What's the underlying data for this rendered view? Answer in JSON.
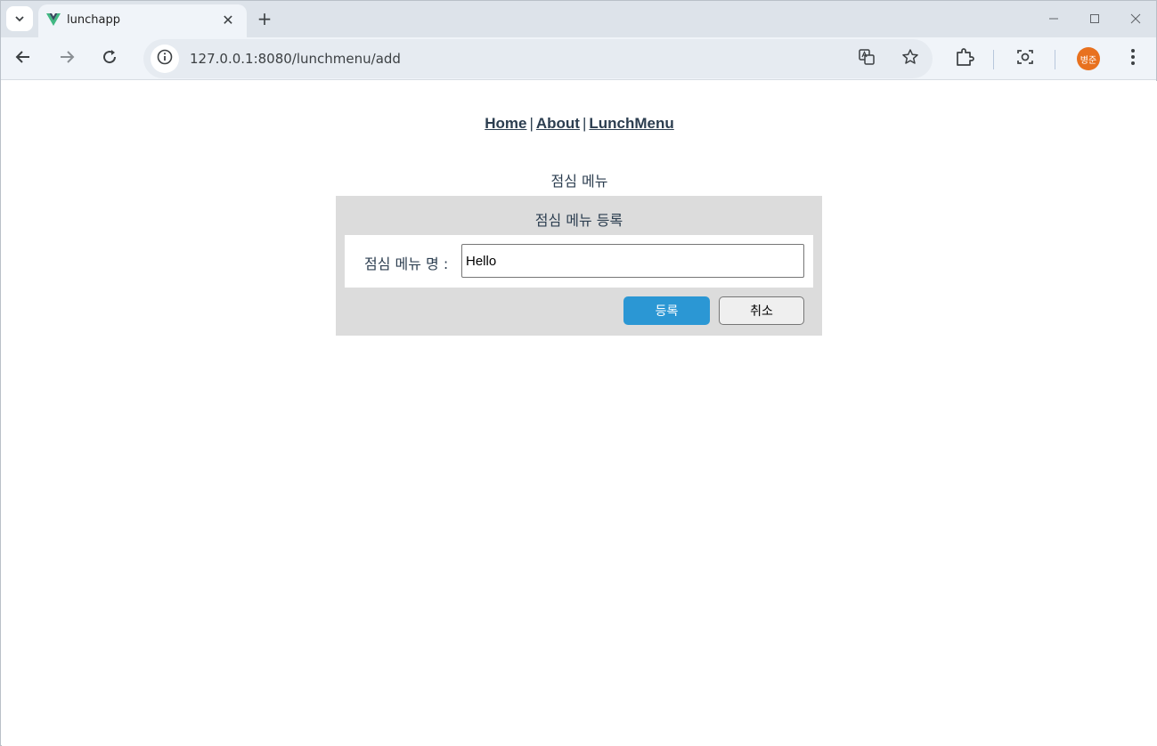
{
  "browser": {
    "tab_title": "lunchapp",
    "tab_close": "✕",
    "new_tab": "+",
    "url": "127.0.0.1:8080/lunchmenu/add",
    "profile_initials": "병준",
    "accent_color": "#e8711f"
  },
  "nav": {
    "items": [
      {
        "label": "Home"
      },
      {
        "label": "About"
      },
      {
        "label": "LunchMenu"
      }
    ],
    "separator": "|"
  },
  "page": {
    "heading": "점심 메뉴",
    "panel_title": "점심 메뉴 등록",
    "field_label": "점심 메뉴 명 :",
    "field_value": "Hello",
    "submit_label": "등록",
    "cancel_label": "취소",
    "submit_color": "#2b97d4"
  }
}
